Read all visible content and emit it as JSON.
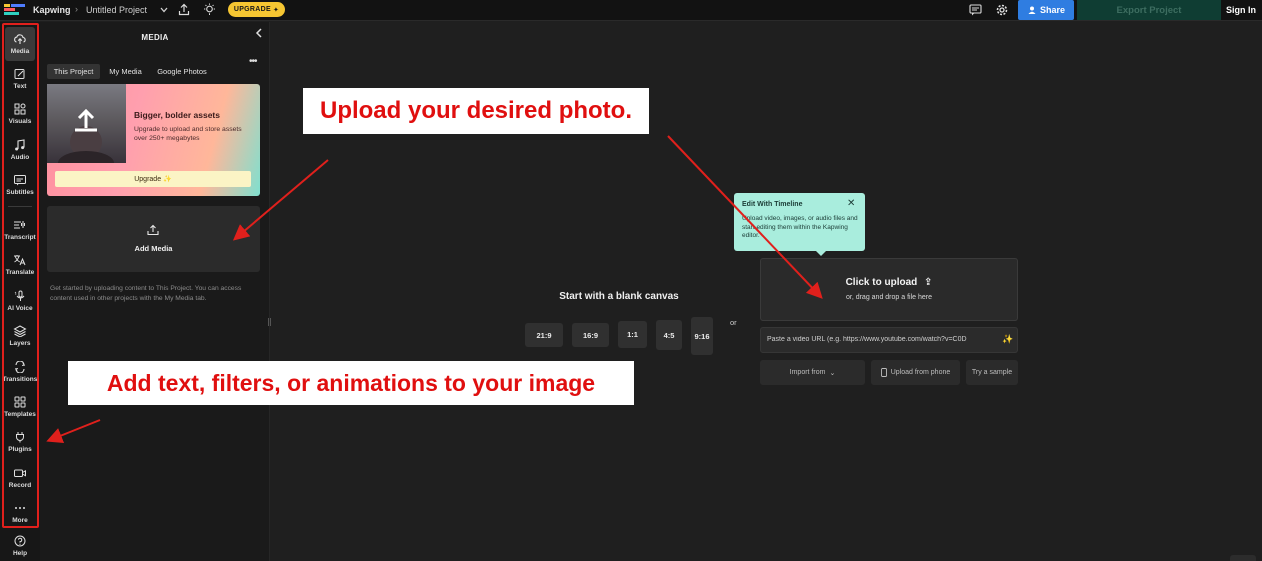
{
  "topbar": {
    "app_name": "Kapwing",
    "project_name": "Untitled Project",
    "upgrade_label": "UPGRADE",
    "share_label": "Share",
    "export_label": "Export Project",
    "signin_label": "Sign In"
  },
  "rail": {
    "items": [
      {
        "label": "Media",
        "icon": "cloud-upload-icon"
      },
      {
        "label": "Text",
        "icon": "edit-text-icon"
      },
      {
        "label": "Visuals",
        "icon": "shapes-icon"
      },
      {
        "label": "Audio",
        "icon": "music-note-icon"
      },
      {
        "label": "Subtitles",
        "icon": "subtitles-icon"
      },
      {
        "label": "Transcript",
        "icon": "transcript-icon"
      },
      {
        "label": "Translate",
        "icon": "translate-icon"
      },
      {
        "label": "AI Voice",
        "icon": "ai-voice-icon"
      },
      {
        "label": "Layers",
        "icon": "layers-icon"
      },
      {
        "label": "Transitions",
        "icon": "transitions-icon"
      },
      {
        "label": "Templates",
        "icon": "templates-icon"
      },
      {
        "label": "Plugins",
        "icon": "plug-icon"
      },
      {
        "label": "Record",
        "icon": "camera-icon"
      },
      {
        "label": "More",
        "icon": "more-dots-icon"
      },
      {
        "label": "Help",
        "icon": "help-icon"
      }
    ]
  },
  "panel": {
    "title": "MEDIA",
    "tabs": [
      "This Project",
      "My Media",
      "Google Photos"
    ],
    "promo": {
      "title": "Bigger, bolder assets",
      "description": "Upgrade to upload and store assets over 250+ megabytes",
      "button": "Upgrade ✨"
    },
    "add_media_label": "Add Media",
    "hint": "Get started by uploading content to This Project. You can access content used in other projects with the My Media tab."
  },
  "canvas": {
    "blank_title": "Start with a blank canvas",
    "ratios": [
      "21:9",
      "16:9",
      "1:1",
      "4:5",
      "9:16"
    ],
    "or_label": "or",
    "upload_title": "Click to upload",
    "upload_sub": "or, drag and drop a file here",
    "url_placeholder": "Paste a video URL (e.g. https://www.youtube.com/watch?v=C0D",
    "import_label": "Import from",
    "phone_label": "Upload from phone",
    "sample_label": "Try a sample"
  },
  "tooltip": {
    "title": "Edit With Timeline",
    "body": "Upload video, images, or audio files and start editing them within the Kapwing editor."
  },
  "annotations": {
    "callout_upload": "Upload your desired photo.",
    "callout_edit": "Add text, filters, or animations to your image",
    "color": "#e0201c"
  }
}
